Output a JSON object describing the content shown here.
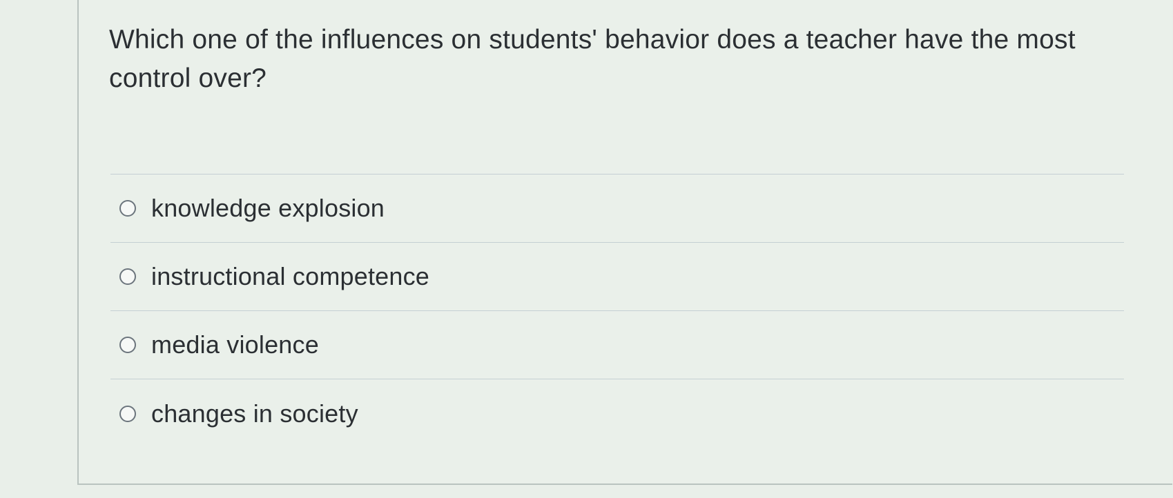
{
  "question": {
    "text": "Which one of the influences on students' behavior does a teacher have the most control over?"
  },
  "options": [
    {
      "label": "knowledge explosion"
    },
    {
      "label": "instructional competence"
    },
    {
      "label": "media violence"
    },
    {
      "label": "changes in society"
    }
  ]
}
